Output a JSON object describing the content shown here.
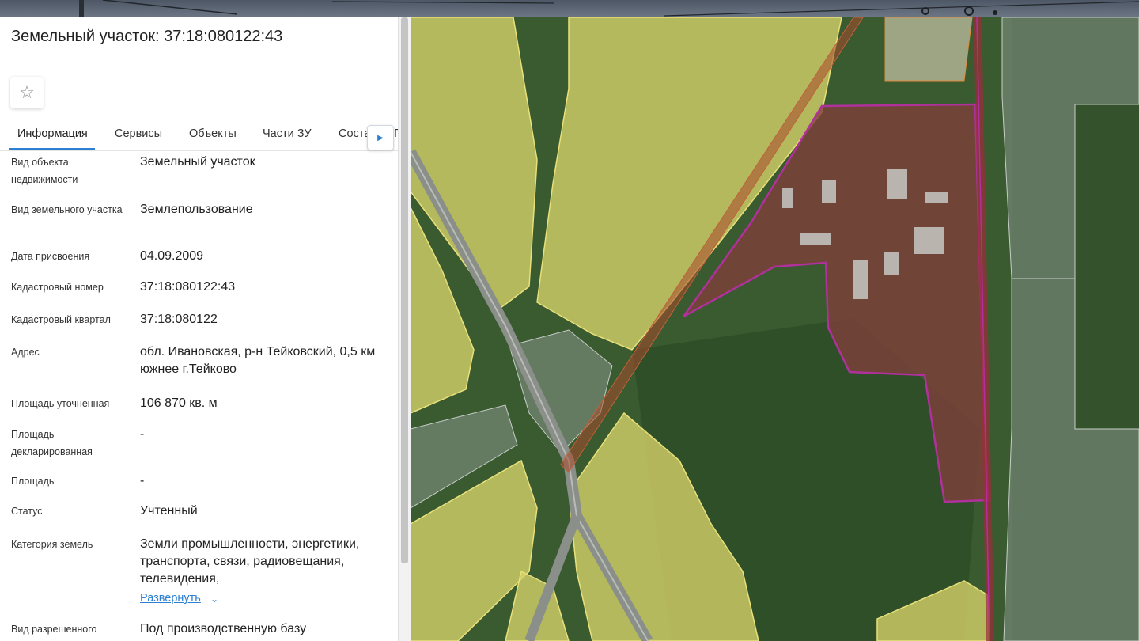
{
  "title": "Земельный участок: 37:18:080122:43",
  "favorite_icon": "star-icon",
  "tabs": [
    {
      "label": "Информация",
      "active": true
    },
    {
      "label": "Сервисы",
      "active": false
    },
    {
      "label": "Объекты",
      "active": false
    },
    {
      "label": "Части ЗУ",
      "active": false
    },
    {
      "label": "Состав ЕЗП",
      "active": false
    }
  ],
  "tab_next_icon": "triangle-right-icon",
  "fields": [
    {
      "label": "Вид объекта недвижимости",
      "value": "Земельный участок"
    },
    {
      "label": "Вид земельного участка",
      "value": "Землепользование"
    },
    {
      "label": "Дата присвоения",
      "value": "04.09.2009"
    },
    {
      "label": "Кадастровый номер",
      "value": "37:18:080122:43"
    },
    {
      "label": "Кадастровый квартал",
      "value": "37:18:080122"
    },
    {
      "label": "Адрес",
      "value": "обл. Ивановская, р-н Тейковский, 0,5 км южнее г.Тейково"
    },
    {
      "label": "Площадь уточненная",
      "value": "106 870 кв. м"
    },
    {
      "label": "Площадь декларированная",
      "value": "-"
    },
    {
      "label": "Площадь",
      "value": "-"
    },
    {
      "label": "Статус",
      "value": "Учтенный"
    },
    {
      "label": "Категория земель",
      "value": "Земли промышленности, энергетики, транспорта, связи, радиовещания, телевидения,"
    },
    {
      "label": "Вид разрешенного",
      "value": "Под производственную базу"
    }
  ],
  "expand_label": "Развернуть",
  "expand_icon": "chevron-down-icon",
  "colors": {
    "accent": "#2d7fd3",
    "parcel_outline": "#b0309c",
    "field_overlay": "#e8e07a"
  }
}
